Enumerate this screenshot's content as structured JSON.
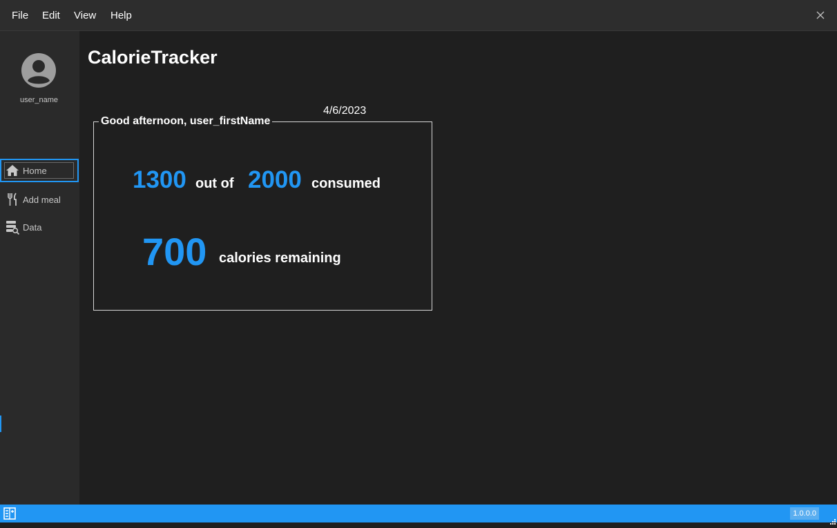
{
  "menubar": {
    "items": [
      "File",
      "Edit",
      "View",
      "Help"
    ]
  },
  "sidebar": {
    "username": "user_name",
    "nav": [
      {
        "label": "Home",
        "icon": "home-icon"
      },
      {
        "label": "Add meal",
        "icon": "utensils-icon"
      },
      {
        "label": "Data",
        "icon": "data-search-icon"
      }
    ]
  },
  "main": {
    "app_title": "CalorieTracker",
    "date": "4/6/2023",
    "greeting": "Good afternoon, user_firstName",
    "consumed": "1300",
    "out_of_label": "out of",
    "goal": "2000",
    "consumed_label": "consumed",
    "remaining": "700",
    "remaining_label": "calories remaining"
  },
  "statusbar": {
    "version": "1.0.0.0"
  },
  "colors": {
    "accent": "#2196f3",
    "background": "#1f1f1f",
    "sidebar": "#2a2a2a",
    "menubar": "#2d2d2d"
  }
}
